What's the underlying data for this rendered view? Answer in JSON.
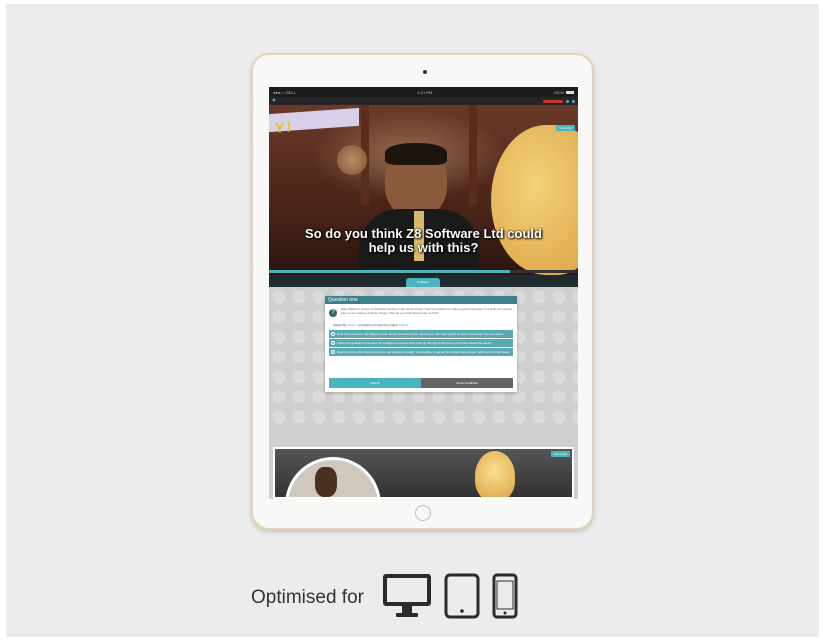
{
  "status_bar": {
    "carrier": "●●●○○ BELL ",
    "time": "4:21 PM",
    "battery": "100%"
  },
  "video": {
    "banner_text": "Y!",
    "subtitle_line1": "So do you think Z8 Software Ltd could",
    "subtitle_line2": "help us with this?",
    "badge": "Transcript"
  },
  "divider": {
    "tab_label": "Collapse"
  },
  "quiz": {
    "title": "Question one",
    "number": "?",
    "question_text": "After William's review of Novanta's Archive Index about things / had Gina asked to make a good impression in a short but serious way on an ordering of these things, what do you think should she do first?",
    "prompt_prefix": "Select the",
    "prompt_link": "answer",
    "prompt_suffix": "you think is correct then select",
    "prompt_link2": "Submit",
    "options": [
      "Gina they someone has diligence and ask the questions then meeting up with signing first and just measuring from new plans.",
      "Follow the guideline procedure for a diligence process and, then go through it with some proof sent ahead the sector",
      "Reach and give the client some time and prepare it quickly, as possible, to get all the signals done ahead, within end of next week"
    ],
    "submit_label": "Submit",
    "feedback_label": "Show Feedback"
  },
  "bottom_video": {
    "badge": "Transcript"
  },
  "footer": {
    "label": "Optimised for"
  },
  "colors": {
    "accent": "#4ab4be",
    "quiz_header": "#3e7f8c",
    "tablet_border": "#e4d3b4",
    "icon_dark": "#2b2b2b"
  }
}
